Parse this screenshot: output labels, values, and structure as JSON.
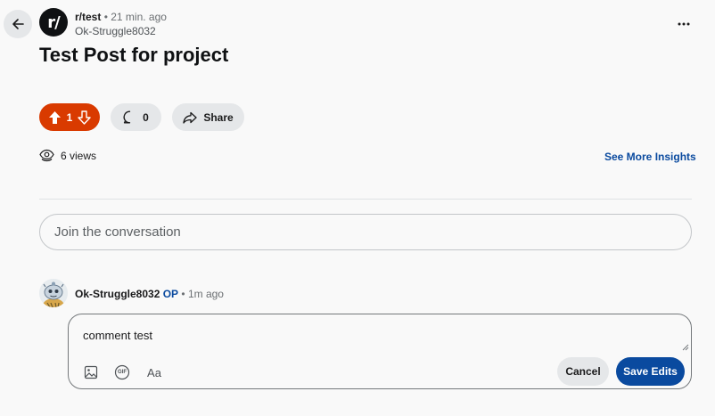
{
  "post": {
    "subreddit": "r/test",
    "time_ago": "21 min. ago",
    "author": "Ok-Struggle8032",
    "title": "Test Post for project",
    "avatar_glyph": "r/"
  },
  "actions": {
    "vote_count": "1",
    "comment_count": "0",
    "share_label": "Share"
  },
  "insights": {
    "views": "6 views",
    "link_label": "See More Insights"
  },
  "join": {
    "placeholder": "Join the conversation"
  },
  "comment": {
    "author": "Ok-Struggle8032",
    "op_badge": "OP",
    "time_ago": "1m ago",
    "text": "comment test",
    "toolbar": {
      "aa_label": "Aa",
      "gif_label": "GIF",
      "cancel_label": "Cancel",
      "save_label": "Save Edits"
    }
  },
  "colors": {
    "upvote_active": "#d93a00",
    "primary_blue": "#0a4a9f",
    "pill_bg": "#e5e7e9"
  },
  "icons": [
    "back-arrow-icon",
    "more-options-icon",
    "upvote-icon",
    "downvote-icon",
    "comment-icon",
    "share-icon",
    "views-icon",
    "image-icon",
    "gif-icon"
  ]
}
